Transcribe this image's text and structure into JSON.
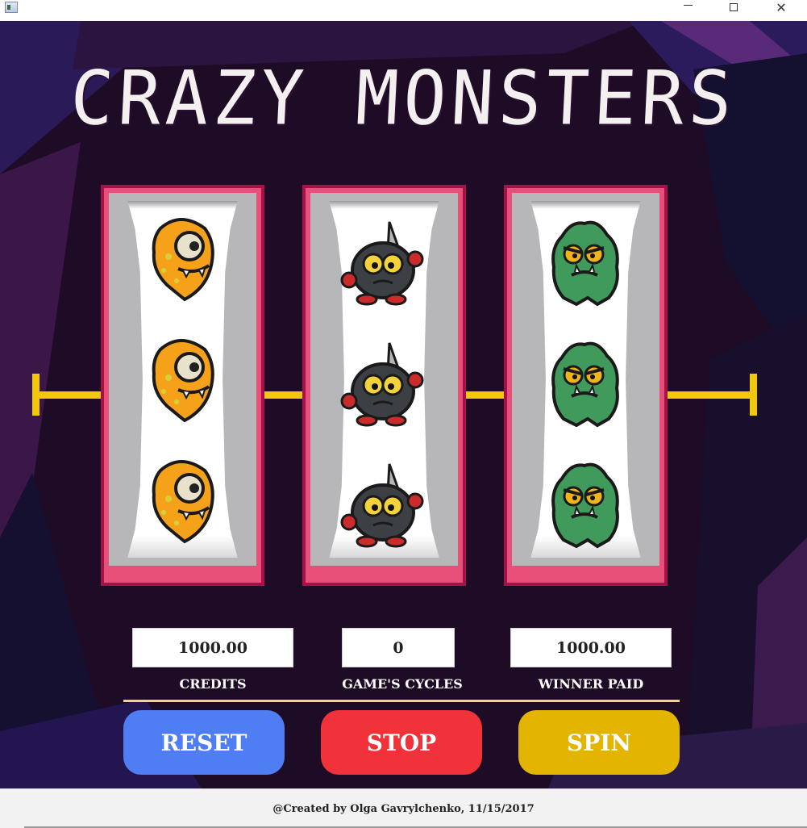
{
  "window": {
    "minimize_label": "—",
    "maximize_label": "☐",
    "close_label": "✕"
  },
  "game": {
    "title": "CRAZY MONSTERS",
    "reels": [
      {
        "monster": "orange-monster-icon",
        "symbols": 3
      },
      {
        "monster": "black-knife-monster-icon",
        "symbols": 3
      },
      {
        "monster": "green-monster-icon",
        "symbols": 3
      }
    ],
    "stats": {
      "credits": {
        "value": "1000.00",
        "label": "CREDITS"
      },
      "cycles": {
        "value": "0",
        "label": "GAME'S CYCLES"
      },
      "winner_paid": {
        "value": "1000.00",
        "label": "WINNER PAID"
      }
    },
    "buttons": {
      "reset": "RESET",
      "stop": "STOP",
      "spin": "SPIN"
    },
    "colors": {
      "reset": "#4f7df4",
      "stop": "#f2323a",
      "spin": "#e3b500",
      "payline": "#f2c80f",
      "reel_frame": "#e8507a"
    }
  },
  "footer": {
    "text": "@Created by Olga Gavrylchenko, 11/15/2017"
  }
}
